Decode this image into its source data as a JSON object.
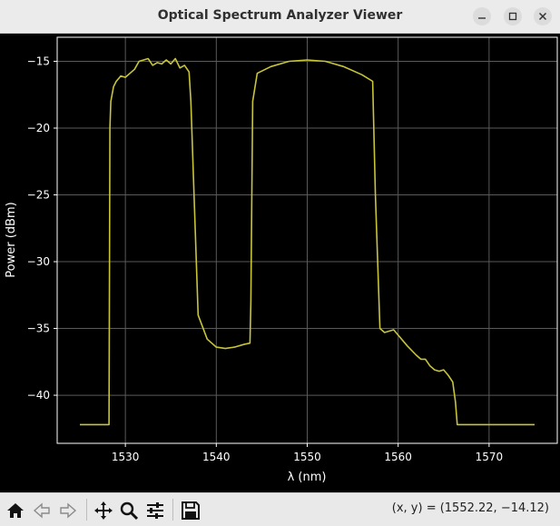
{
  "window": {
    "title": "Optical Spectrum Analyzer Viewer",
    "controls": [
      "minimize-icon",
      "maximize-icon",
      "close-icon"
    ]
  },
  "toolbar": {
    "buttons": [
      "home-icon",
      "back-arrow-icon",
      "forward-arrow-icon",
      "pan-icon",
      "zoom-icon",
      "configure-subplots-icon",
      "save-icon"
    ],
    "coords_text": "(x, y) = (1552.22, −14.12)"
  },
  "chart_data": {
    "type": "line",
    "xlabel": "λ (nm)",
    "ylabel": "Power (dBm)",
    "xlim": [
      1522.5,
      1577.5
    ],
    "ylim": [
      -43.6,
      -13.2
    ],
    "xticks": [
      1530,
      1540,
      1550,
      1560,
      1570
    ],
    "yticks": [
      -15,
      -20,
      -25,
      -30,
      -35,
      -40
    ],
    "grid": true,
    "colors": {
      "line": "#c8c43a",
      "background": "#000000",
      "grid": "#5a5a5a",
      "text": "#ffffff"
    },
    "series": [
      {
        "x": [
          1525.0,
          1528.2,
          1528.3,
          1528.4,
          1528.7,
          1529.0,
          1529.5,
          1530.0,
          1531.0,
          1531.5,
          1532.5,
          1533.0,
          1533.5,
          1534.0,
          1534.5,
          1535.0,
          1535.5,
          1536.0,
          1536.5,
          1537.0,
          1537.2,
          1538.0,
          1539.0,
          1540.0,
          1541.0,
          1542.0,
          1543.0,
          1543.7,
          1543.8,
          1544.0,
          1544.5,
          1546.0,
          1548.0,
          1550.0,
          1552.0,
          1554.0,
          1556.0,
          1557.2,
          1557.5,
          1558.0,
          1558.5,
          1559.0,
          1559.5,
          1560.0,
          1561.0,
          1562.0,
          1562.5,
          1563.0,
          1563.5,
          1564.0,
          1564.5,
          1565.0,
          1565.5,
          1566.0,
          1566.3,
          1566.5,
          1575.0
        ],
        "y": [
          -42.2,
          -42.2,
          -20.0,
          -18.0,
          -16.9,
          -16.5,
          -16.1,
          -16.2,
          -15.6,
          -15.0,
          -14.8,
          -15.3,
          -15.1,
          -15.2,
          -14.9,
          -15.2,
          -14.8,
          -15.5,
          -15.3,
          -15.8,
          -18.0,
          -34.0,
          -35.8,
          -36.4,
          -36.5,
          -36.4,
          -36.2,
          -36.1,
          -33.0,
          -18.0,
          -15.9,
          -15.4,
          -15.0,
          -14.9,
          -15.0,
          -15.4,
          -16.0,
          -16.5,
          -25.0,
          -35.0,
          -35.3,
          -35.2,
          -35.1,
          -35.5,
          -36.3,
          -37.0,
          -37.3,
          -37.3,
          -37.8,
          -38.1,
          -38.2,
          -38.1,
          -38.5,
          -39.0,
          -40.5,
          -42.2,
          -42.2
        ]
      }
    ]
  }
}
